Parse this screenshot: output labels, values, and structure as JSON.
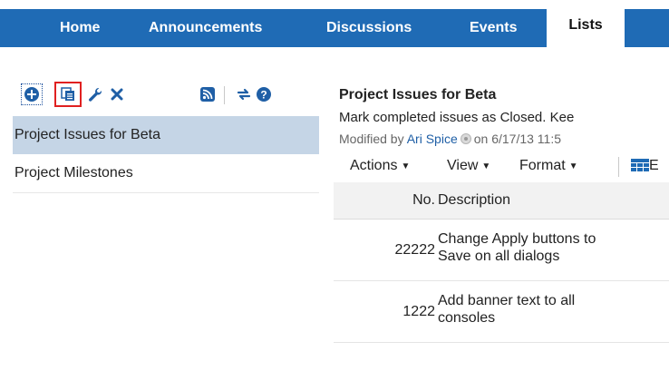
{
  "nav": {
    "tabs": [
      {
        "label": "Home"
      },
      {
        "label": "Announcements"
      },
      {
        "label": "Discussions"
      },
      {
        "label": "Events"
      },
      {
        "label": "Lists",
        "active": true
      }
    ]
  },
  "left_toolbar": {
    "icons": [
      "add-icon",
      "copy-icon",
      "wrench-icon",
      "delete-icon",
      "rss-icon",
      "refresh-icon",
      "help-icon"
    ]
  },
  "lists": [
    {
      "label": "Project Issues for Beta",
      "selected": true
    },
    {
      "label": "Project Milestones"
    }
  ],
  "detail": {
    "title": "Project Issues for Beta",
    "description": "Mark completed issues as Closed. Kee",
    "modified_prefix": "Modified by",
    "modified_user": "Ari Spice",
    "modified_on": "on 6/17/13 11:5"
  },
  "table_toolbar": {
    "actions": "Actions",
    "view": "View",
    "format": "Format",
    "edit_label": "E"
  },
  "table": {
    "columns": [
      "No.",
      "Description"
    ],
    "rows": [
      {
        "no": "22222",
        "desc_line1": "Change Apply buttons to",
        "desc_line2": "Save on all dialogs"
      },
      {
        "no": "1222",
        "desc_line1": "Add banner text to all",
        "desc_line2": "consoles"
      }
    ]
  },
  "colors": {
    "nav_bg": "#1f6bb5",
    "selected_row": "#c5d5e6",
    "link": "#1f5fa6",
    "highlight_border": "#e02020"
  }
}
